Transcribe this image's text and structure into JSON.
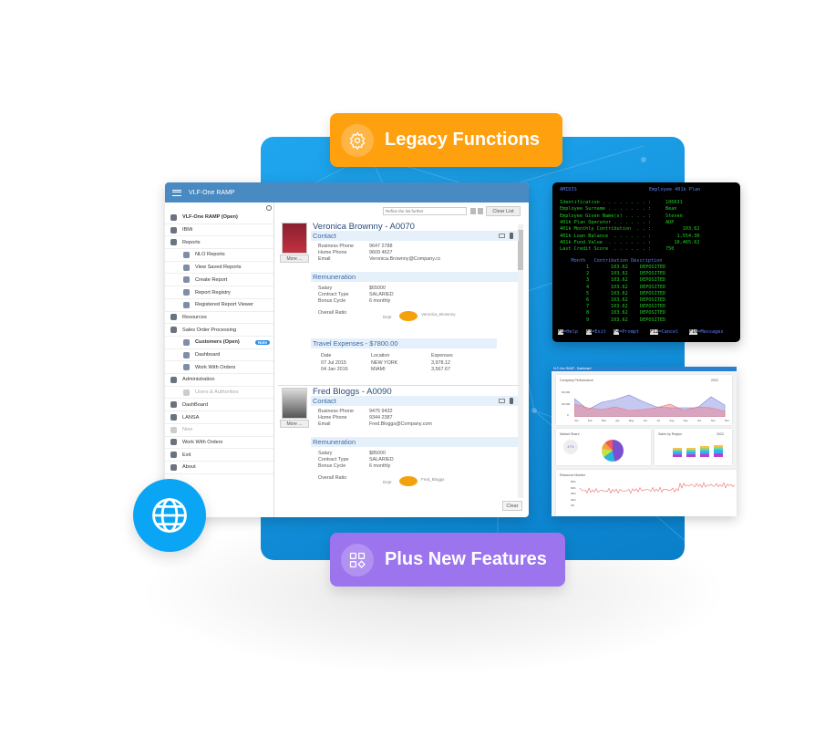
{
  "banners": {
    "legacy": "Legacy Functions",
    "plus": "Plus New Features"
  },
  "colors": {
    "blue_panel": "#1294de",
    "legacy": "#ffa00f",
    "plus": "#9b74ee",
    "globe": "#0aa5f5",
    "header": "#4a8ac2"
  },
  "window": {
    "title": "VLF-One RAMP",
    "sidebar": [
      {
        "label": "VLF-One RAMP (Open)",
        "icon": "globe-icon",
        "level": 0,
        "bold": true
      },
      {
        "label": "IBMi",
        "icon": "document-icon",
        "level": 0
      },
      {
        "label": "Reports",
        "icon": "chart-icon",
        "level": 0
      },
      {
        "label": "NLO Reports",
        "icon": "chat-icon",
        "level": 1
      },
      {
        "label": "View Saved Reports",
        "icon": "search-document-icon",
        "level": 1
      },
      {
        "label": "Create Report",
        "icon": "edit-icon",
        "level": 1
      },
      {
        "label": "Report Registry",
        "icon": "document-icon",
        "level": 1
      },
      {
        "label": "Registered Report Viewer",
        "icon": "checklist-icon",
        "level": 1
      },
      {
        "label": "Resources",
        "icon": "bank-icon",
        "level": 0
      },
      {
        "label": "Sales Order Processing",
        "icon": "globe-icon",
        "level": 0
      },
      {
        "label": "Customers (Open)",
        "icon": "users-icon",
        "level": 1,
        "bold": true,
        "badge": "Note"
      },
      {
        "label": "Dashboard",
        "icon": "dashboard-icon",
        "level": 1
      },
      {
        "label": "Work With Orders",
        "icon": "list-icon",
        "level": 1
      },
      {
        "label": "Administration",
        "icon": "clipboard-icon",
        "level": 0
      },
      {
        "label": "Users & Authorities",
        "icon": "document-icon",
        "level": 1,
        "disabled": true
      },
      {
        "label": "DashBoard",
        "icon": "globe-icon",
        "level": 0
      },
      {
        "label": "LANSA",
        "icon": "info-icon",
        "level": 0
      },
      {
        "label": "New",
        "icon": "plus-icon",
        "level": 0,
        "disabled": true
      },
      {
        "label": "Work With Orders",
        "icon": "document-icon",
        "level": 0
      },
      {
        "label": "Exit",
        "icon": "close-icon",
        "level": 0
      },
      {
        "label": "About",
        "icon": "info-icon",
        "level": 0
      }
    ],
    "search_placeholder": "Refine the list further",
    "clear_list": "Clear List",
    "clear": "Clear",
    "more": "More ...",
    "cards": [
      {
        "name": "Veronica Brownny - A0070",
        "contact": "Contact",
        "business_phone_label": "Business Phone",
        "business_phone": "9647 2788",
        "home_phone_label": "Home Phone",
        "home_phone": "9609 4627",
        "email_label": "Email",
        "email": "Veronica.Brownny@Company.cc",
        "remuneration": "Remuneration",
        "salary_label": "Salary",
        "salary": "$65000",
        "contract_label": "Contract Type",
        "contract": "SALARIED",
        "bonus_label": "Bonus Cycle",
        "bonus": "6 monthly",
        "ratio_label": "Overall Ratio",
        "ratio_left": "Dept",
        "ratio_right": "Veronica_Brownny",
        "travel": {
          "title": "Travel Expenses - $7800.00",
          "headers": [
            "Date",
            "Location",
            "Expenses"
          ],
          "rows": [
            [
              "07 Jul 2015",
              "NEW YORK",
              "3,978.12"
            ],
            [
              "04 Jan 2016",
              "MIAMI",
              "3,567.67"
            ]
          ]
        }
      },
      {
        "name": "Fred Bloggs - A0090",
        "contact": "Contact",
        "business_phone_label": "Business Phone",
        "business_phone": "9475 9432",
        "home_phone_label": "Home Phone",
        "home_phone": "9344 2387",
        "email_label": "Email",
        "email": "Fred.Bloggs@Company.com",
        "remuneration": "Remuneration",
        "salary_label": "Salary",
        "salary": "$85000",
        "contract_label": "Contract Type",
        "contract": "SALARIED",
        "bonus_label": "Bonus Cycle",
        "bonus": "6 monthly",
        "ratio_label": "Overall Ratio",
        "ratio_left": "Dept",
        "ratio_right": "Fred_Bloggs"
      }
    ]
  },
  "terminal": {
    "program": "AMIDIS",
    "title": "Employee 401k Plan",
    "fields": [
      [
        "Identification . . . . . . . . :",
        "106631"
      ],
      [
        "Employee Surname . . . . . . . :",
        "Bean"
      ],
      [
        "Employee Given Name(s) . . . . :",
        "Steven"
      ],
      [
        "401k Plan Operator . . . . . . :",
        "ADP"
      ],
      [
        "401k Monthly Contribution  . . :",
        "      103.62"
      ],
      [
        "401k Loan Balance  . . . . . . :",
        "    1,554.30"
      ],
      [
        "401k Fund Value  . . . . . . . :",
        "   10,465.62"
      ],
      [
        "Last Credit Score  . . . . . . :",
        "750"
      ]
    ],
    "table_header": "    Month   Contribution Description",
    "rows": [
      [
        "1",
        "103.62",
        "DEPOSITED"
      ],
      [
        "2",
        "103.62",
        "DEPOSITED"
      ],
      [
        "3",
        "103.62",
        "DEPOSITED"
      ],
      [
        "4",
        "103.62",
        "DEPOSITED"
      ],
      [
        "5",
        "103.62",
        "DEPOSITED"
      ],
      [
        "6",
        "103.62",
        "DEPOSITED"
      ],
      [
        "7",
        "103.62",
        "DEPOSITED"
      ],
      [
        "8",
        "103.62",
        "DEPOSITED"
      ],
      [
        "9",
        "103.62",
        "DEPOSITED"
      ]
    ],
    "keys": [
      [
        "F1",
        "Help"
      ],
      [
        "F3",
        "Exit"
      ],
      [
        "F4",
        "Prompt"
      ],
      [
        "F12",
        "Cancel"
      ],
      [
        "F16",
        "Messages"
      ]
    ]
  },
  "dashboard": {
    "title": "VLF-One RAMP - Dashboard",
    "performance": {
      "title": "Company Performance",
      "year": "2022",
      "yticks": [
        "60,000",
        "30,000",
        "0"
      ],
      "months": [
        "Jan",
        "Feb",
        "Mar",
        "Apr",
        "May",
        "Jun",
        "Jul",
        "Aug",
        "Sep",
        "Oct",
        "Nov",
        "Dec"
      ]
    },
    "market": {
      "title": "Market Share",
      "value": "47%"
    },
    "region": {
      "title": "Sales by Region",
      "year": "2022"
    },
    "resource": {
      "title": "Resource Monitor",
      "yticks": [
        "80%",
        "60%",
        "40%",
        "20%",
        "0%"
      ]
    }
  }
}
